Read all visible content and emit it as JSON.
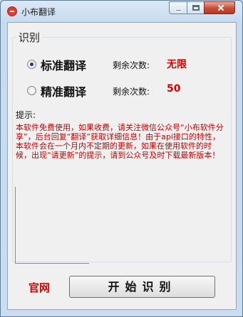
{
  "window": {
    "title": "小布翻译"
  },
  "group": {
    "title": "识别"
  },
  "modes": [
    {
      "label": "标准翻译",
      "count_label": "剩余次数:",
      "count_value": "无限",
      "selected": true
    },
    {
      "label": "精准翻译",
      "count_label": "剩余次数:",
      "count_value": "50",
      "selected": false
    }
  ],
  "hint": {
    "label": "提示:",
    "text": "本软件免费使用，如果收费，请关注微信公众号“小布软件分享”，后台回复“翻译”获取详细信息！由于api接口的特性，本软件会在一个月内不定期的更新，如果在使用软件的时候，出现“请更新”的提示，请到公众号及时下载最新版本！"
  },
  "footer": {
    "official_link": "官网",
    "start_button": "开始识别"
  },
  "colors": {
    "accent_red": "#d40000",
    "hint_red": "#c00000"
  },
  "icons": {
    "app": "app-icon",
    "minimize": "minimize-icon",
    "maximize": "maximize-icon",
    "close": "close-icon"
  }
}
